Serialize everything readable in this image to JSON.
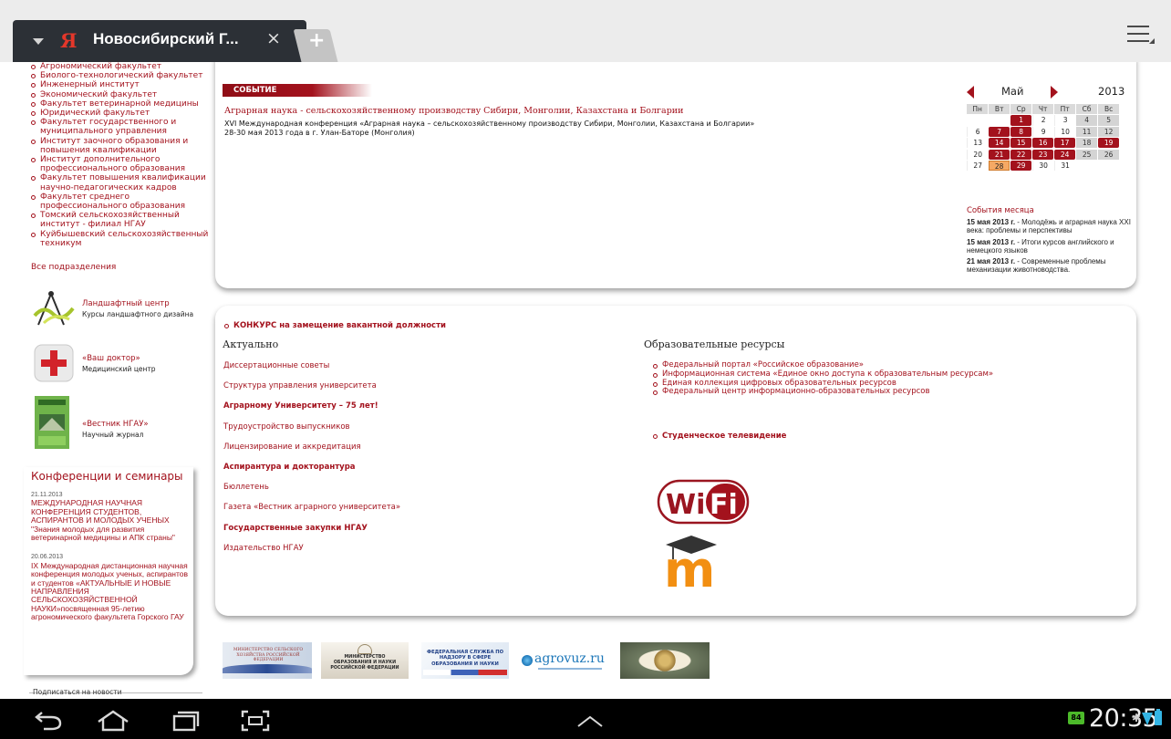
{
  "browser": {
    "tab_title": "Новосибирский Г...",
    "tab_favicon": "Я",
    "close_glyph": "×",
    "new_tab_glyph": "+",
    "icons": [
      "chevron-down-icon",
      "yandex-favicon-icon",
      "close-icon",
      "new-tab-icon",
      "menu-icon"
    ]
  },
  "sidebar": {
    "faculties": [
      "Агрономический факультет",
      "Биолого-технологический факультет",
      "Инженерный институт",
      "Экономический факультет",
      "Факультет ветеринарной медицины",
      "Юридический факультет",
      "Факультет государственного и муниципального управления",
      "Институт заочного образования и повышения квалификации",
      "Институт дополнительного профессионального образования",
      "Факультет повышения квалификации научно-педагогических кадров",
      "Факультет среднего профессионального образования",
      "Томский сельскохозяйственный институт - филиал НГАУ",
      "Куйбышевский сельскохозяйственный техникум"
    ],
    "all_units": "Все подразделения",
    "promos": [
      {
        "title": "Ландшафтный центр",
        "subtitle": "Курсы ландшафтного дизайна"
      },
      {
        "title": "«Ваш доктор»",
        "subtitle": "Медицинский центр"
      },
      {
        "title": "«Вестник НГАУ»",
        "subtitle": "Научный журнал"
      }
    ],
    "conferences": {
      "title": "Конференции и семинары",
      "items": [
        {
          "date": "21.11.2013",
          "text": "МЕЖДУНАРОДНАЯ НАУЧНАЯ КОНФЕРЕНЦИЯ СТУДЕНТОВ, АСПИРАНТОВ И МОЛОДЫХ УЧЕНЫХ \"Знания молодых для развития ветеринарной медицины и АПК страны\""
        },
        {
          "date": "20.06.2013",
          "text": "IX Международная дистанционная научная конференция молодых ученых, аспирантов и студентов «АКТУАЛЬНЫЕ И НОВЫЕ НАПРАВЛЕНИЯ СЕЛЬСКОХОЗЯЙСТВЕННОЙ НАУКИ»посвященная 95-летию агрономического факультета Горского ГАУ"
        }
      ]
    },
    "subscribe": "Подписаться на новости"
  },
  "event": {
    "badge": "СОБЫТИЕ",
    "link": "Аграрная наука - сельскохозяйственному производству Сибири, Монголии, Казахстана и Болгарии",
    "desc1": "XVI Международная конференция «Аграрная наука – сельскохозяйственному производству Сибири, Монголии, Казахстана и Болгарии»",
    "desc2": "28-30 мая 2013 года в  г. Улан-Баторе  (Монголия)"
  },
  "calendar": {
    "month": "Май",
    "year": "2013",
    "weekdays": [
      "Пн",
      "Вт",
      "Ср",
      "Чт",
      "Пт",
      "Сб",
      "Вс"
    ],
    "weeks": [
      [
        "",
        "",
        "1",
        "2",
        "3",
        "4",
        "5"
      ],
      [
        "6",
        "7",
        "8",
        "9",
        "10",
        "11",
        "12"
      ],
      [
        "13",
        "14",
        "15",
        "16",
        "17",
        "18",
        "19"
      ],
      [
        "20",
        "21",
        "22",
        "23",
        "24",
        "25",
        "26"
      ],
      [
        "27",
        "28",
        "29",
        "30",
        "31",
        "",
        ""
      ]
    ],
    "event_days": [
      "1",
      "7",
      "8",
      "14",
      "15",
      "16",
      "17",
      "19",
      "21",
      "22",
      "23",
      "24",
      "29"
    ],
    "today": "28",
    "month_events_title": "События месяца",
    "month_events": [
      {
        "date": "15 мая 2013 г.",
        "text": " - Молодёжь и аграрная наука XXI века: проблемы и перспективы"
      },
      {
        "date": "15 мая 2013 г.",
        "text": " - Итоги курсов английского и немецкого языков"
      },
      {
        "date": "21 мая 2013 г.",
        "text": " - Современные проблемы механизации животноводства."
      }
    ]
  },
  "main": {
    "vacancy": "КОНКУРС на замещение вакантной должности",
    "actual_title": "Актуально",
    "actual_items": [
      {
        "label": "Диссертационные советы",
        "bold": false
      },
      {
        "label": "Структура управления университета",
        "bold": false
      },
      {
        "label": "Аграрному Университету – 75 лет!",
        "bold": true
      },
      {
        "label": "Трудоустройство выпускников",
        "bold": false
      },
      {
        "label": "Лицензирование и аккредитация",
        "bold": false
      },
      {
        "label": "Аспирантура и докторантура",
        "bold": true
      },
      {
        "label": "Бюллетень",
        "bold": false
      },
      {
        "label": "Газета «Вестник аграрного университета»",
        "bold": false
      },
      {
        "label": "Государственные закупки НГАУ",
        "bold": true
      },
      {
        "label": "Издательство НГАУ",
        "bold": false
      }
    ],
    "edu_title": "Образовательные ресурсы",
    "edu_items": [
      "Федеральный портал «Российское образование»",
      "Информационная система «Единое окно доступа к образовательным ресурсам»",
      "Единая коллекция цифровых образовательных ресурсов",
      "Федеральный центр информационно-образовательных ресурсов"
    ],
    "student_tv": "Студенческое телевидение",
    "wifi_logo": {
      "left": "Wi",
      "right": "Fi"
    },
    "moodle_logo": "m"
  },
  "partners": {
    "p1": "МИНИСТЕРСТВО СЕЛЬСКОГО ХОЗЯЙСТВА РОССИЙСКОЙ ФЕДЕРАЦИИ",
    "p2": "МИНИСТЕРСТВО ОБРАЗОВАНИЯ И НАУКИ РОССИЙСКОЙ ФЕДЕРАЦИИ",
    "p3": "ФЕДЕРАЛЬНАЯ СЛУЖБА ПО НАДЗОРУ В СФЕРЕ ОБРАЗОВАНИЯ И НАУКИ",
    "p4": "agrovuz.ru"
  },
  "system_bar": {
    "battery_badge": "84",
    "clock": "20:35",
    "bt_glyph": "✱",
    "icons": [
      "back-icon",
      "home-icon",
      "recent-apps-icon",
      "screenshot-icon",
      "up-chevron-icon",
      "bluetooth-icon",
      "wifi-signal-icon",
      "battery-icon"
    ]
  },
  "colors": {
    "accent": "#a3121d",
    "tab_bg": "#2c3036",
    "today": "#f5a964",
    "system_blue": "#34b5e5"
  }
}
